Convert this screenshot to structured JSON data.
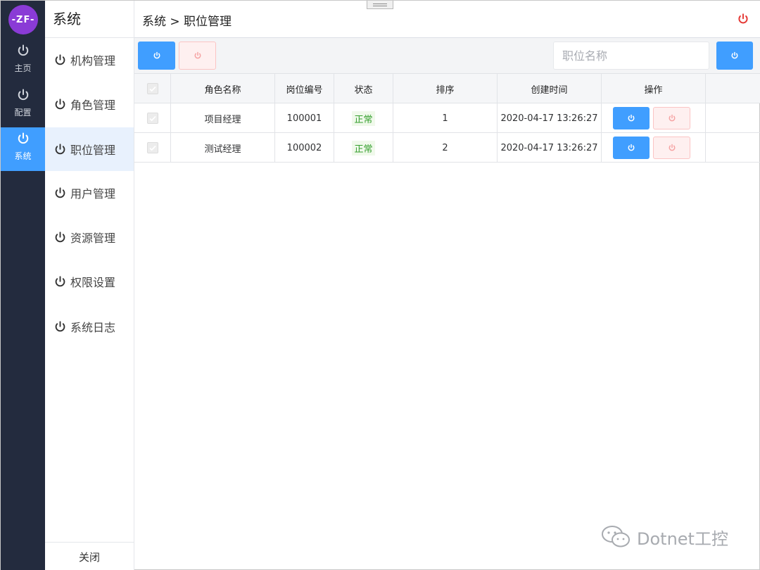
{
  "logo": {
    "text": "-ZF-"
  },
  "rail": {
    "items": [
      {
        "label": "主页",
        "icon": "power-icon",
        "active": false
      },
      {
        "label": "配置",
        "icon": "power-icon",
        "active": false
      },
      {
        "label": "系统",
        "icon": "power-icon",
        "active": true
      }
    ]
  },
  "menu": {
    "title": "系统",
    "items": [
      {
        "label": "机构管理",
        "icon": "power-icon",
        "active": false
      },
      {
        "label": "角色管理",
        "icon": "power-icon",
        "active": false
      },
      {
        "label": "职位管理",
        "icon": "power-icon",
        "active": true
      },
      {
        "label": "用户管理",
        "icon": "power-icon",
        "active": false
      },
      {
        "label": "资源管理",
        "icon": "power-icon",
        "active": false
      },
      {
        "label": "权限设置",
        "icon": "power-icon",
        "active": false
      },
      {
        "label": "系统日志",
        "icon": "power-icon",
        "active": false
      }
    ],
    "close_label": "关闭"
  },
  "header": {
    "breadcrumb": "系统 > 职位管理",
    "power_icon": "power-icon",
    "power_color": "#e53935"
  },
  "toolbar": {
    "search_placeholder": "职位名称",
    "search_value": ""
  },
  "table": {
    "columns": [
      "角色名称",
      "岗位编号",
      "状态",
      "排序",
      "创建时间",
      "操作"
    ],
    "rows": [
      {
        "name": "项目经理",
        "code": "100001",
        "status": "正常",
        "order": "1",
        "created": "2020-04-17 13:26:27",
        "checked": true
      },
      {
        "name": "测试经理",
        "code": "100002",
        "status": "正常",
        "order": "2",
        "created": "2020-04-17 13:26:27",
        "checked": true
      }
    ]
  },
  "colors": {
    "rail_bg": "#232b3e",
    "primary": "#409eff",
    "danger_bg": "#fef0f0",
    "danger_border": "#fbc4c4",
    "status_text": "#35a02e",
    "logo_bg": "#8a3bd6"
  },
  "watermark": {
    "text": "Dotnet工控",
    "icon": "wechat-icon"
  }
}
